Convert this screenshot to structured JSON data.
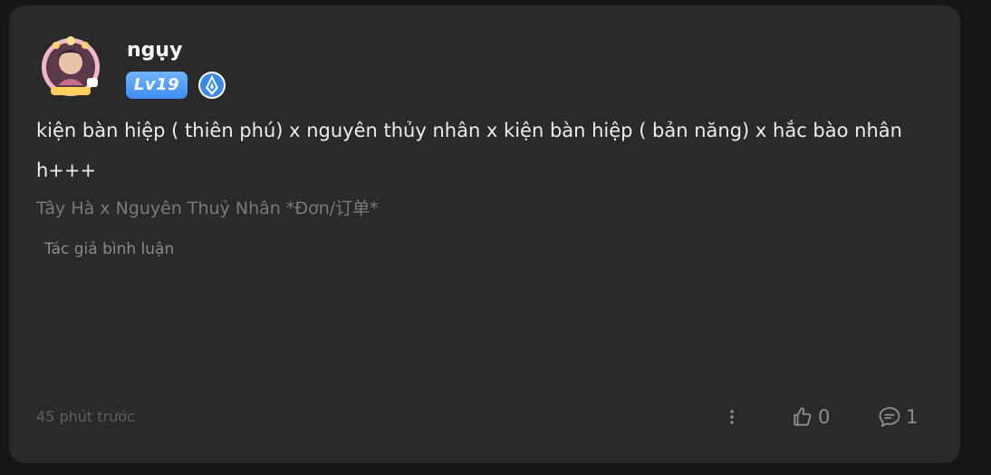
{
  "post": {
    "username": "ngụy",
    "level_badge": "Lv19",
    "content": "kiện bàn hiệp ( thiên phú) x nguyên thủy nhân x kiện bàn hiệp ( bản năng) x hắc bào nhân h+++",
    "source": "Tây Hà x Nguyên Thuỷ Nhân *Đơn/订单*",
    "author_comment_label": "Tác giả bình luận",
    "timestamp": "45 phút trước",
    "like_count": "0",
    "comment_count": "1",
    "icons": {
      "avatar": "avatar-image",
      "rank": "rank-badge-icon",
      "more": "more-vertical-icon",
      "like": "thumbs-up-icon",
      "comment": "comment-bubble-icon"
    },
    "colors": {
      "page_bg": "#161616",
      "card_bg": "#2a2a2a",
      "level_badge": "#4a96f7",
      "rank_icon": "#3b89e8",
      "content_text": "#ececec",
      "muted_text": "#7a7a7a"
    }
  }
}
